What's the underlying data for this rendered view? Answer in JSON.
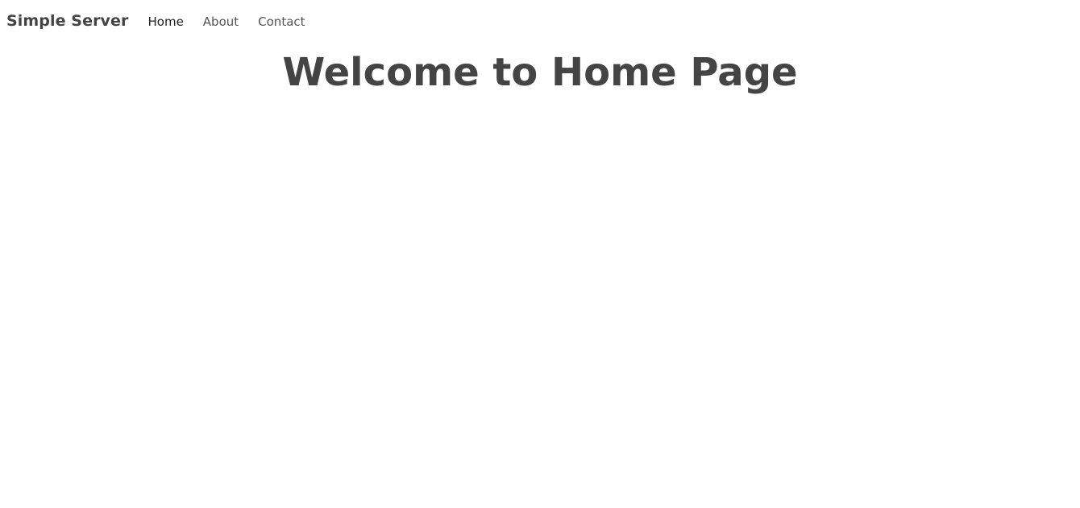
{
  "navbar": {
    "brand": "Simple Server",
    "links": [
      {
        "label": "Home",
        "active": true
      },
      {
        "label": "About",
        "active": false
      },
      {
        "label": "Contact",
        "active": false
      }
    ]
  },
  "main": {
    "title": "Welcome to Home Page"
  },
  "colors": {
    "text": "#444444",
    "background": "#ffffff"
  }
}
